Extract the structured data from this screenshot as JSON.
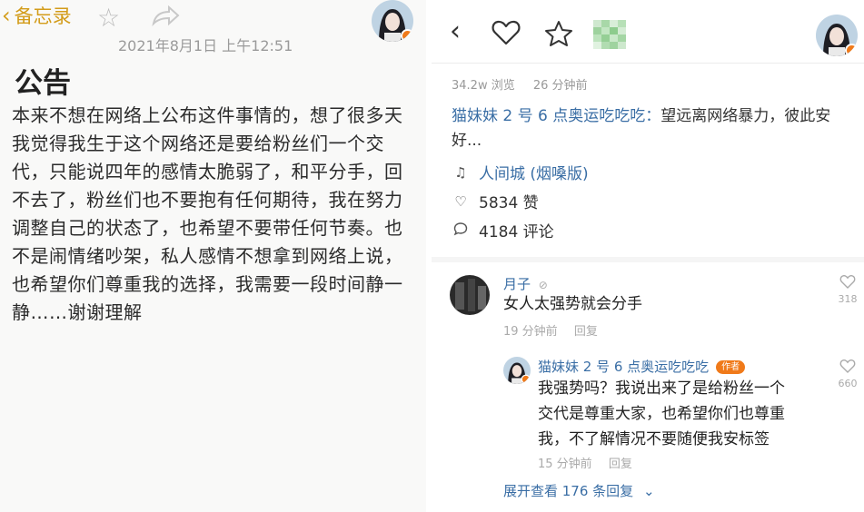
{
  "note": {
    "back_label": "备忘录",
    "datetime": "2021年8月1日 上午12:51",
    "title": "公告",
    "body_lines": [
      "本来不想在网络上公布这件事情的，想了很多天",
      "我觉得我生于这个网络还是要给粉丝们一个交",
      "代，只能说四年的感情太脆弱了，和平分手，回",
      "不去了，粉丝们也不要抱有任何期待，我在努力",
      "调整自己的状态了，也希望不要带任何节奏。也",
      "不是闹情绪吵架，私人感情不想拿到网络上说，",
      "也希望你们尊重我的选择，我需要一段时间静一",
      "静……谢谢理解"
    ],
    "accent_color": "#d39c1a"
  },
  "post": {
    "views": "34.2w 浏览",
    "time_ago": "26 分钟前",
    "author": "猫妹妹 2 号 6 点奥运吃吃吃：",
    "summary": "望远离网络暴力，彼此安好...",
    "music": "人间城 (烟嗓版)",
    "likes": "5834 赞",
    "comments": "4184 评论",
    "link_color": "#3a6ea5"
  },
  "comments": [
    {
      "name": "月子",
      "text": "女人太强势就会分手",
      "time": "19 分钟前",
      "reply_label": "回复",
      "likes": "318"
    },
    {
      "name": "猫妹妹 2 号 6 点奥运吃吃吃",
      "badge": "作者",
      "text_lines": [
        "我强势吗？我说出来了是给粉丝一个",
        "交代是尊重大家，也希望你们也尊重",
        "我，不了解情况不要随便我安标签"
      ],
      "time": "15 分钟前",
      "reply_label": "回复",
      "likes": "660"
    }
  ],
  "expand_label": "展开查看 176 条回复"
}
